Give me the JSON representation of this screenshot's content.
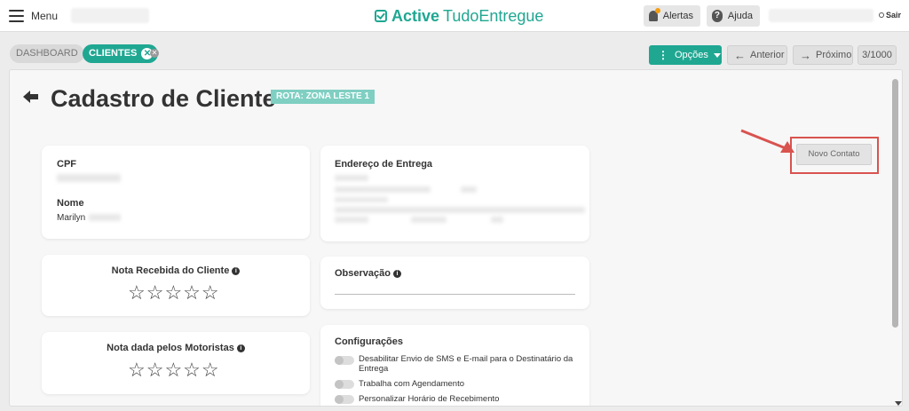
{
  "topbar": {
    "menu_label": "Menu",
    "logo_bold": "Active",
    "logo_light": "TudoEntregue",
    "alerts_label": "Alertas",
    "help_label": "Ajuda",
    "help_icon_text": "?",
    "logout_label": "Sair"
  },
  "tabs": {
    "dashboard": "DASHBOARD",
    "clientes": "CLIENTES",
    "close_glyph": "✕"
  },
  "toolbar": {
    "options_label": "Opções",
    "prev_label": "Anterior",
    "next_label": "Próximo",
    "counter": "3/1000"
  },
  "page": {
    "title": "Cadastro de Cliente",
    "rota_badge": "ROTA: ZONA LESTE 1",
    "new_contact_label": "Novo Contato"
  },
  "client": {
    "cpf_label": "CPF",
    "name_label": "Nome",
    "name_value": "Marilyn"
  },
  "address": {
    "label": "Endereço de Entrega"
  },
  "ratings": {
    "client_rating_label": "Nota Recebida do Cliente",
    "driver_rating_label": "Nota dada pelos Motoristas",
    "client_rating": 0,
    "driver_rating": 0,
    "max": 5,
    "stars_text": "☆☆☆☆☆",
    "info_glyph": "i"
  },
  "observation": {
    "label": "Observação",
    "value": ""
  },
  "settings": {
    "label": "Configurações",
    "toggles": [
      {
        "label": "Desabilitar Envio de SMS e E-mail para o Destinatário da Entrega",
        "on": false
      },
      {
        "label": "Trabalha com Agendamento",
        "on": false
      },
      {
        "label": "Personalizar Horário de Recebimento",
        "on": false
      }
    ]
  },
  "colors": {
    "brand": "#1fa792",
    "badge": "#7fcfc2",
    "annotation": "#d9534f"
  }
}
